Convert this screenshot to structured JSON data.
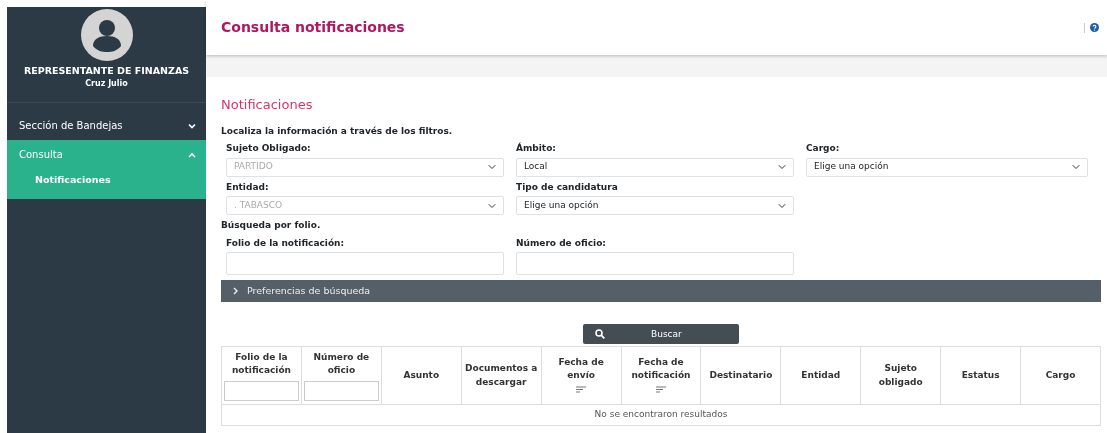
{
  "sidebar": {
    "role": "REPRESENTANTE DE FINANZAS",
    "user": "Cruz Julio",
    "items": [
      {
        "label": "Sección de Bandejas",
        "expanded": false,
        "selected": false
      },
      {
        "label": "Consulta",
        "expanded": true,
        "selected": true,
        "children": [
          {
            "label": "Notificaciones"
          }
        ]
      }
    ]
  },
  "header": {
    "title": "Consulta notificaciones"
  },
  "section_title": "Notificaciones",
  "filters_hint": "Localiza la información a través de los filtros.",
  "filter_rows": [
    [
      {
        "kind": "select",
        "label": "Sujeto Obligado:",
        "value": "PARTIDO",
        "disabled": true
      },
      {
        "kind": "select",
        "label": "Ámbito:",
        "value": "Local",
        "disabled": false
      },
      {
        "kind": "select",
        "label": "Cargo:",
        "value": "Elige una opción",
        "disabled": false
      }
    ],
    [
      {
        "kind": "select",
        "label": "Entidad:",
        "value": ". TABASCO",
        "disabled": true
      },
      {
        "kind": "select",
        "label": "Tipo de candidatura",
        "value": "Elige una opción",
        "disabled": false
      }
    ]
  ],
  "folio_hint": "Búsqueda por folio.",
  "folio_rows": [
    [
      {
        "kind": "text",
        "label": "Folio de la notificación:",
        "disabled": false
      },
      {
        "kind": "text",
        "label": "Número de oficio:",
        "disabled": false
      }
    ]
  ],
  "preferences": {
    "label": "Preferencias de búsqueda",
    "expanded": false
  },
  "search_button": "Buscar",
  "table": {
    "columns": [
      {
        "label": "Folio de la notificación",
        "filter": true,
        "sortable": false
      },
      {
        "label": "Número de oficio",
        "filter": true,
        "sortable": false
      },
      {
        "label": "Asunto",
        "filter": false,
        "sortable": false
      },
      {
        "label": "Documentos a descargar",
        "filter": false,
        "sortable": false
      },
      {
        "label": "Fecha de envío",
        "filter": false,
        "sortable": true
      },
      {
        "label": "Fecha de notificación",
        "filter": false,
        "sortable": true
      },
      {
        "label": "Destinatario",
        "filter": false,
        "sortable": false
      },
      {
        "label": "Entidad",
        "filter": false,
        "sortable": false
      },
      {
        "label": "Sujeto obligado",
        "filter": false,
        "sortable": false
      },
      {
        "label": "Estatus",
        "filter": false,
        "sortable": false
      },
      {
        "label": "Cargo",
        "filter": false,
        "sortable": false
      }
    ],
    "empty_message": "No se encontraron resultados"
  }
}
